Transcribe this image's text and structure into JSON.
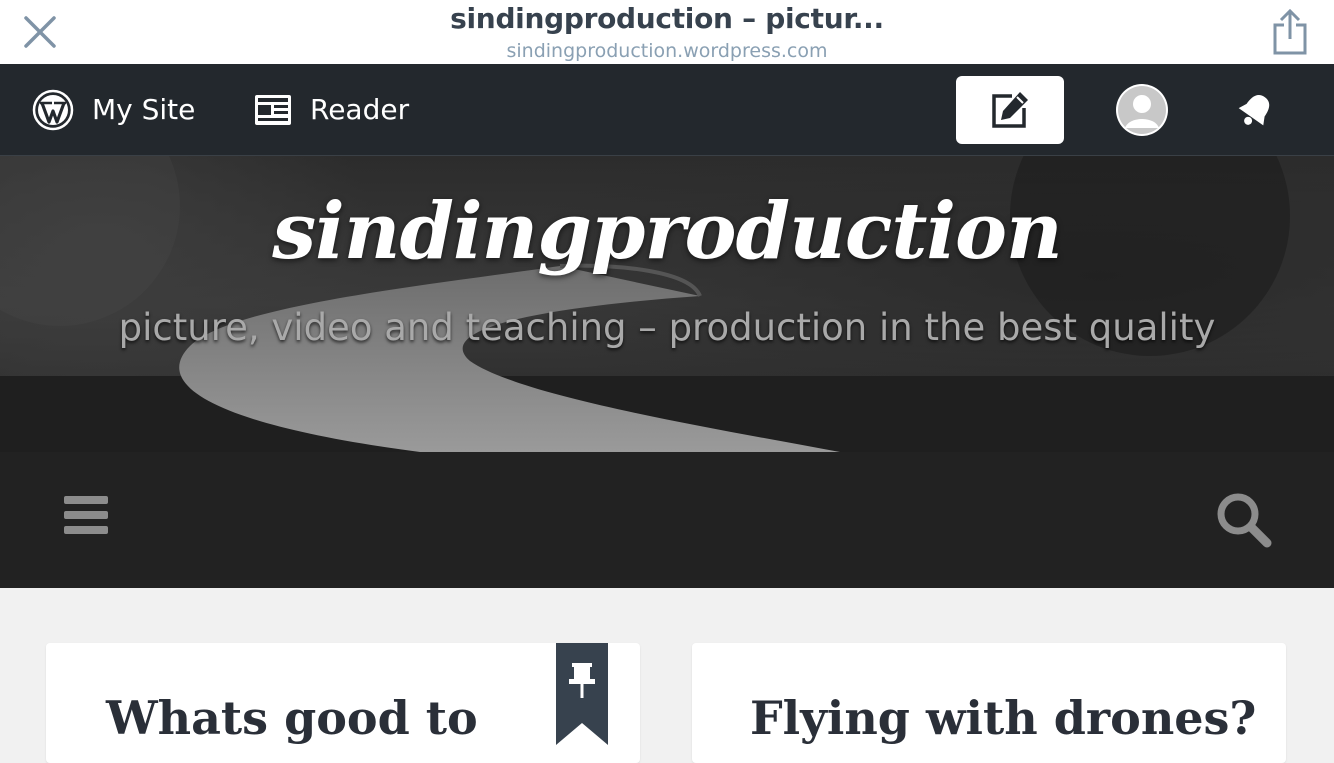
{
  "browser": {
    "title": "sindingproduction – pictur...",
    "url": "sindingproduction.wordpress.com"
  },
  "toolbar": {
    "my_site_label": "My Site",
    "reader_label": "Reader",
    "icons": [
      "wordpress-logo-icon",
      "reader-icon",
      "write-post-icon",
      "avatar",
      "notifications-bell-icon"
    ]
  },
  "header": {
    "site_title": "sindingproduction",
    "tagline": "picture, video and teaching – production in the best quality"
  },
  "nav": {
    "icons": [
      "hamburger-menu-icon",
      "search-icon"
    ]
  },
  "posts": [
    {
      "title": "Whats good to",
      "sticky": true
    },
    {
      "title": "Flying with drones?",
      "sticky": false
    }
  ],
  "colors": {
    "toolbar_bg": "#23282d",
    "nav_bg": "#222222",
    "content_bg": "#f1f1f1",
    "ribbon": "#37424e"
  }
}
